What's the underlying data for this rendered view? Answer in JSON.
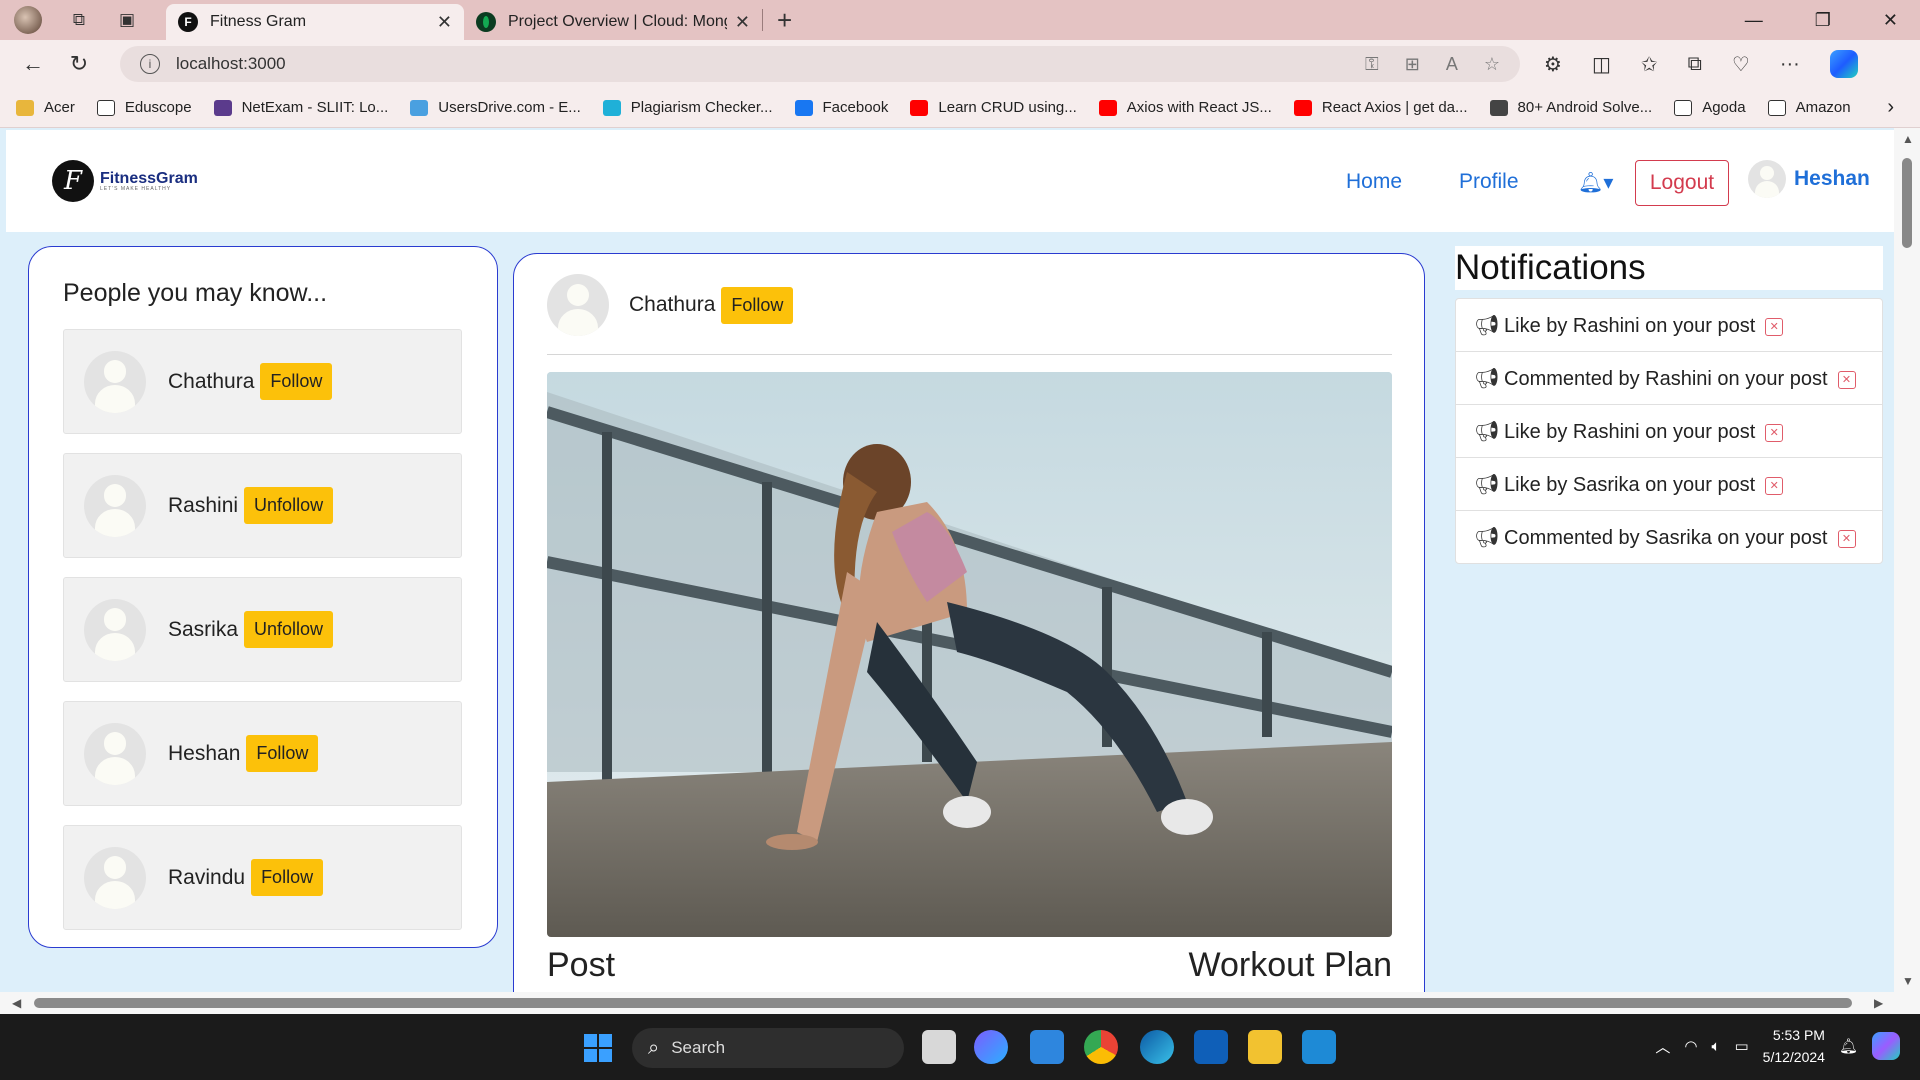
{
  "browser": {
    "tabs": [
      {
        "title": "Fitness Gram",
        "close": "✕",
        "favicon": "F"
      },
      {
        "title": "Project Overview | Cloud: MongoDB",
        "close": "✕",
        "favicon": "leaf"
      }
    ],
    "new_tab": "+",
    "url": "localhost:3000",
    "bookmarks": [
      {
        "label": "Acer",
        "icon": "folder-icon",
        "color": "#e8b63c"
      },
      {
        "label": "Eduscope",
        "icon": "page-icon",
        "color": "#ffffff"
      },
      {
        "label": "NetExam - SLIIT: Lo...",
        "icon": "sliit-icon",
        "color": "#5b3b8c"
      },
      {
        "label": "UsersDrive.com - E...",
        "icon": "cloud-icon",
        "color": "#4aa0e0"
      },
      {
        "label": "Plagiarism Checker...",
        "icon": "plag-icon",
        "color": "#1fb0d8"
      },
      {
        "label": "Facebook",
        "icon": "facebook-icon",
        "color": "#1877f2"
      },
      {
        "label": "Learn CRUD using...",
        "icon": "youtube-icon",
        "color": "#ff0000"
      },
      {
        "label": "Axios with React JS...",
        "icon": "youtube-icon",
        "color": "#ff0000"
      },
      {
        "label": "React Axios | get da...",
        "icon": "youtube-icon",
        "color": "#ff0000"
      },
      {
        "label": "80+ Android Solve...",
        "icon": "medium-icon",
        "color": "#444444"
      },
      {
        "label": "Agoda",
        "icon": "page-icon",
        "color": "#ffffff"
      },
      {
        "label": "Amazon",
        "icon": "page-icon",
        "color": "#ffffff"
      }
    ]
  },
  "app": {
    "nav": {
      "logo_letter": "F",
      "logo_text": "FitnessGram",
      "logo_tagline": "LET'S MAKE HEALTHY",
      "home": "Home",
      "profile": "Profile",
      "logout": "Logout",
      "username": "Heshan"
    },
    "suggestions": {
      "title": "People you may know...",
      "people": [
        {
          "name": "Chathura",
          "action": "Follow"
        },
        {
          "name": "Rashini",
          "action": "Unfollow"
        },
        {
          "name": "Sasrika",
          "action": "Unfollow"
        },
        {
          "name": "Heshan",
          "action": "Follow"
        },
        {
          "name": "Ravindu",
          "action": "Follow"
        }
      ]
    },
    "post": {
      "author": "Chathura",
      "action": "Follow",
      "left_label": "Post",
      "right_label": "Workout Plan"
    },
    "notifications": {
      "title": "Notifications",
      "items": [
        {
          "text": "Like by Rashini on your post"
        },
        {
          "text": "Commented by Rashini on your post"
        },
        {
          "text": "Like by Rashini on your post"
        },
        {
          "text": "Like by Sasrika on your post"
        },
        {
          "text": "Commented by Sasrika on your post"
        }
      ]
    }
  },
  "taskbar": {
    "search_placeholder": "Search",
    "time": "5:53 PM",
    "date": "5/12/2024"
  }
}
